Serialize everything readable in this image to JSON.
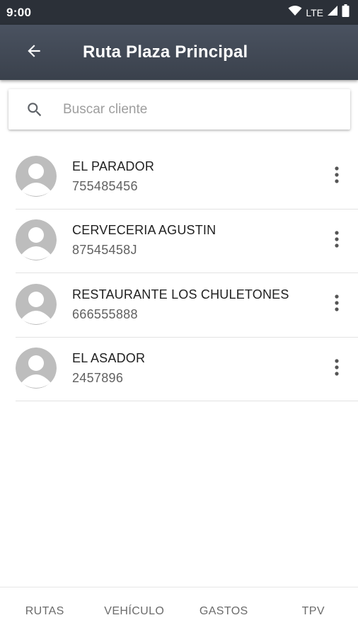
{
  "status_bar": {
    "time": "9:00",
    "network": "LTE",
    "icons": [
      "wifi-icon",
      "signal-icon",
      "battery-icon"
    ]
  },
  "app_bar": {
    "back_icon": "arrow-back-icon",
    "title": "Ruta Plaza Principal"
  },
  "search": {
    "icon": "search-icon",
    "placeholder": "Buscar cliente",
    "value": ""
  },
  "clients": [
    {
      "name": "EL PARADOR",
      "code": "755485456"
    },
    {
      "name": "CERVECERIA AGUSTIN",
      "code": "87545458J"
    },
    {
      "name": "RESTAURANTE LOS CHULETONES",
      "code": "666555888"
    },
    {
      "name": "EL ASADOR",
      "code": "2457896"
    }
  ],
  "bottom_nav": {
    "items": [
      {
        "label": "RUTAS"
      },
      {
        "label": "VEHÍCULO"
      },
      {
        "label": "GASTOS"
      },
      {
        "label": "TPV"
      }
    ]
  },
  "colors": {
    "status_bar": "#2b3038",
    "app_bar": "#434a56",
    "avatar_bg": "#bdbdbd",
    "divider": "#e2e2e2",
    "nav_text": "#6b6b6b"
  }
}
